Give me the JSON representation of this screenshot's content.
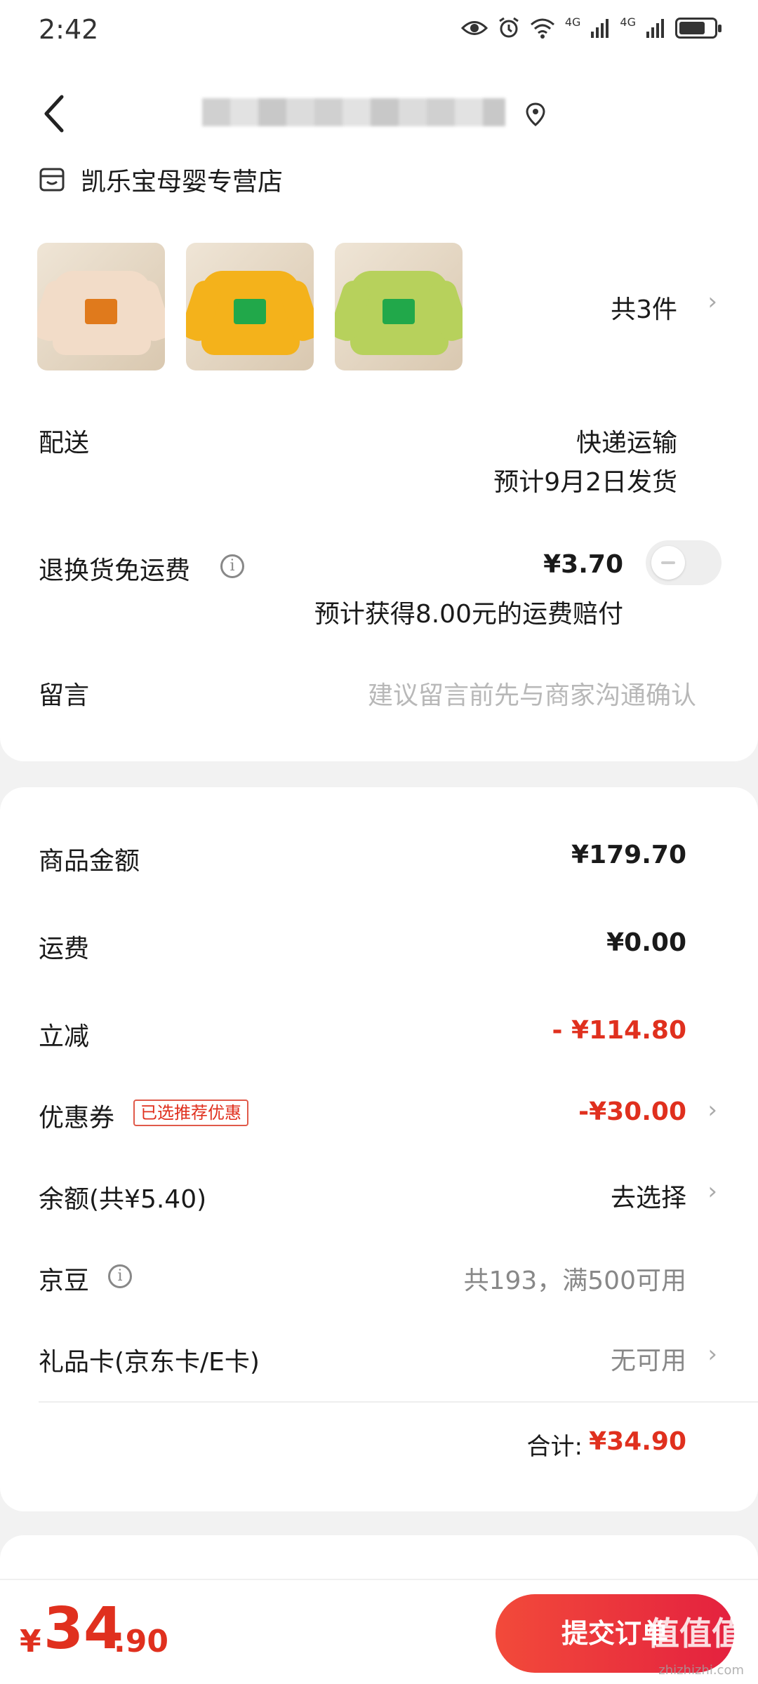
{
  "status_bar": {
    "time": "2:42",
    "network_1": "4G",
    "network_2": "4G",
    "battery_level": 0.75
  },
  "header": {
    "store_name": "凯乐宝母婴专营店"
  },
  "products": {
    "thumbs": [
      {
        "shirt_color": "#f2dcc8",
        "logo_color": "#e07a1c"
      },
      {
        "shirt_color": "#f4b21b",
        "logo_color": "#21a84a"
      },
      {
        "shirt_color": "#b7d15c",
        "logo_color": "#21a84a"
      }
    ],
    "count_label": "共3件"
  },
  "delivery": {
    "label": "配送",
    "method": "快递运输",
    "estimate": "预计9月2日发货"
  },
  "return_shipping": {
    "label": "退换货免运费",
    "price": "¥3.70",
    "compensation": "预计获得8.00元的运费赔付",
    "enabled": false
  },
  "message": {
    "label": "留言",
    "placeholder": "建议留言前先与商家沟通确认"
  },
  "summary": {
    "goods_label": "商品金额",
    "goods_value": "¥179.70",
    "shipping_label": "运费",
    "shipping_value": "¥0.00",
    "instant_discount_label": "立减",
    "instant_discount_value": "- ¥114.80",
    "coupon_label": "优惠券",
    "coupon_tag": "已选推荐优惠",
    "coupon_value": "-¥30.00",
    "balance_label": "余额(共¥5.40)",
    "balance_action": "去选择",
    "jingdou_label": "京豆",
    "jingdou_value": "共193，满500可用",
    "giftcard_label": "礼品卡(京东卡/E卡)",
    "giftcard_value": "无可用",
    "total_label": "合计:",
    "total_value": "¥34.90"
  },
  "bottom": {
    "currency": "¥",
    "price_int": "34",
    "price_dec": ".90",
    "submit_label": "提交订单",
    "watermark": "值值值",
    "watermark_sub": "zhizhizhi.com"
  },
  "colors": {
    "accent": "#e0301e",
    "text": "#1a1a1a",
    "secondary": "#888888"
  }
}
